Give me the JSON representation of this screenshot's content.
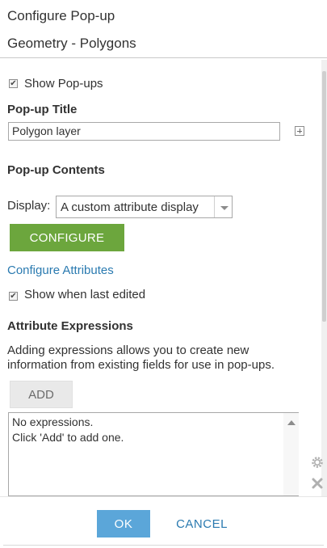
{
  "header": {
    "title": "Configure Pop-up",
    "subtitle": "Geometry - Polygons"
  },
  "show_popups": {
    "label": "Show Pop-ups",
    "checked": true
  },
  "popup_title": {
    "heading": "Pop-up Title",
    "value": "Polygon layer",
    "expand_icon": "plus-square-icon"
  },
  "popup_contents": {
    "heading": "Pop-up Contents",
    "display_label": "Display:",
    "display_value": "A custom attribute display",
    "configure_label": "CONFIGURE",
    "configure_attributes_link": "Configure Attributes",
    "show_last_edited": {
      "label": "Show when last edited",
      "checked": true
    }
  },
  "attribute_expressions": {
    "heading": "Attribute Expressions",
    "description_line1": "Adding expressions allows you to create new",
    "description_line2": "information from existing fields for use in pop-ups.",
    "add_label": "ADD",
    "empty_line1": "No expressions.",
    "empty_line2": "Click 'Add' to add one."
  },
  "footer": {
    "ok_label": "OK",
    "cancel_label": "CANCEL"
  },
  "icons": {
    "check": "checkmark-icon",
    "dropdown": "caret-down-icon",
    "gear": "gear-icon",
    "delete": "close-x-icon",
    "scroll_up": "triangle-up-icon"
  },
  "colors": {
    "configure_button": "#6ca63d",
    "ok_button": "#5ba6d9",
    "link": "#2a7ab0"
  }
}
